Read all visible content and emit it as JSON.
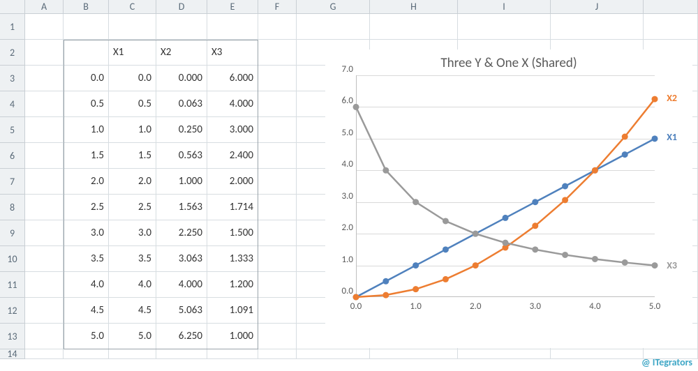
{
  "columns": [
    "A",
    "B",
    "C",
    "D",
    "E",
    "F",
    "G",
    "H",
    "I",
    "J",
    ""
  ],
  "row_numbers": [
    1,
    2,
    3,
    4,
    5,
    6,
    7,
    8,
    9,
    10,
    11,
    12,
    13,
    14
  ],
  "table": {
    "headers": {
      "C": "X1",
      "D": "X2",
      "E": "X3"
    },
    "rows": [
      {
        "B": "0.0",
        "C": "0.0",
        "D": "0.000",
        "E": "6.000"
      },
      {
        "B": "0.5",
        "C": "0.5",
        "D": "0.063",
        "E": "4.000"
      },
      {
        "B": "1.0",
        "C": "1.0",
        "D": "0.250",
        "E": "3.000"
      },
      {
        "B": "1.5",
        "C": "1.5",
        "D": "0.563",
        "E": "2.400"
      },
      {
        "B": "2.0",
        "C": "2.0",
        "D": "1.000",
        "E": "2.000"
      },
      {
        "B": "2.5",
        "C": "2.5",
        "D": "1.563",
        "E": "1.714"
      },
      {
        "B": "3.0",
        "C": "3.0",
        "D": "2.250",
        "E": "1.500"
      },
      {
        "B": "3.5",
        "C": "3.5",
        "D": "3.063",
        "E": "1.333"
      },
      {
        "B": "4.0",
        "C": "4.0",
        "D": "4.000",
        "E": "1.200"
      },
      {
        "B": "4.5",
        "C": "4.5",
        "D": "5.063",
        "E": "1.091"
      },
      {
        "B": "5.0",
        "C": "5.0",
        "D": "6.250",
        "E": "1.000"
      }
    ]
  },
  "chart_data": {
    "type": "line",
    "title": "Three Y & One X (Shared)",
    "xlabel": "",
    "ylabel": "",
    "xlim": [
      0.0,
      5.0
    ],
    "ylim": [
      0.0,
      7.0
    ],
    "xticks": [
      0.0,
      1.0,
      2.0,
      3.0,
      4.0,
      5.0
    ],
    "yticks": [
      0.0,
      1.0,
      2.0,
      3.0,
      4.0,
      5.0,
      6.0,
      7.0
    ],
    "x": [
      0.0,
      0.5,
      1.0,
      1.5,
      2.0,
      2.5,
      3.0,
      3.5,
      4.0,
      4.5,
      5.0
    ],
    "series": [
      {
        "name": "X1",
        "color": "#4f81bd",
        "values": [
          0.0,
          0.5,
          1.0,
          1.5,
          2.0,
          2.5,
          3.0,
          3.5,
          4.0,
          4.5,
          5.0
        ]
      },
      {
        "name": "X2",
        "color": "#ed7d31",
        "values": [
          0.0,
          0.063,
          0.25,
          0.563,
          1.0,
          1.563,
          2.25,
          3.063,
          4.0,
          5.063,
          6.25
        ]
      },
      {
        "name": "X3",
        "color": "#9a9a9a",
        "values": [
          6.0,
          4.0,
          3.0,
          2.4,
          2.0,
          1.714,
          1.5,
          1.333,
          1.2,
          1.091,
          1.0
        ]
      }
    ],
    "legend_position": "right"
  },
  "series_labels": {
    "X1": "X1",
    "X2": "X2",
    "X3": "X3"
  },
  "watermark": "@ ITegrators"
}
